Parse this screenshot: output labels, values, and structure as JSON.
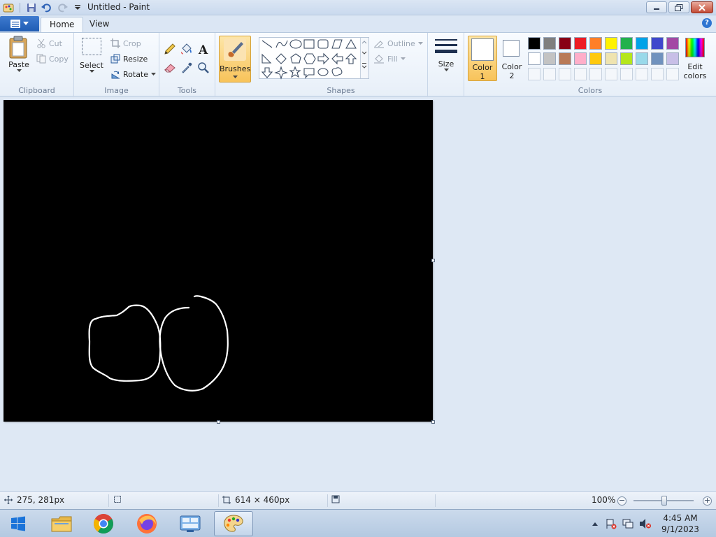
{
  "window": {
    "title": "Untitled - Paint"
  },
  "tabs": [
    {
      "label": "Home"
    },
    {
      "label": "View"
    }
  ],
  "ribbon": {
    "clipboard": {
      "label": "Clipboard",
      "paste": "Paste",
      "cut": "Cut",
      "copy": "Copy"
    },
    "image": {
      "label": "Image",
      "select": "Select",
      "crop": "Crop",
      "resize": "Resize",
      "rotate": "Rotate"
    },
    "tools": {
      "label": "Tools"
    },
    "brushes": {
      "label": "Brushes"
    },
    "shapes": {
      "label": "Shapes",
      "outline": "Outline",
      "fill": "Fill"
    },
    "size": {
      "label": "Size"
    },
    "colors": {
      "label": "Colors",
      "color1_label": "Color",
      "color1_num": "1",
      "color2_label": "Color",
      "color2_num": "2",
      "edit_label": "Edit",
      "edit_label2": "colors",
      "color1_value": "#ffffff",
      "color2_value": "#ffffff",
      "palette_row1": [
        "#000000",
        "#7f7f7f",
        "#880015",
        "#ed1c24",
        "#ff7f27",
        "#fff200",
        "#22b14c",
        "#00a2e8",
        "#3f48cc",
        "#a349a4"
      ],
      "palette_row2": [
        "#ffffff",
        "#c3c3c3",
        "#b97a57",
        "#ffaec9",
        "#ffc90e",
        "#efe4b0",
        "#b5e61d",
        "#99d9ea",
        "#7092be",
        "#c8bfe7"
      ]
    }
  },
  "status": {
    "cursor_pos": "275, 281px",
    "canvas_size": "614 × 460px",
    "zoom": "100%"
  },
  "taskbar": {
    "time": "4:45 AM",
    "date": "9/1/2023"
  }
}
